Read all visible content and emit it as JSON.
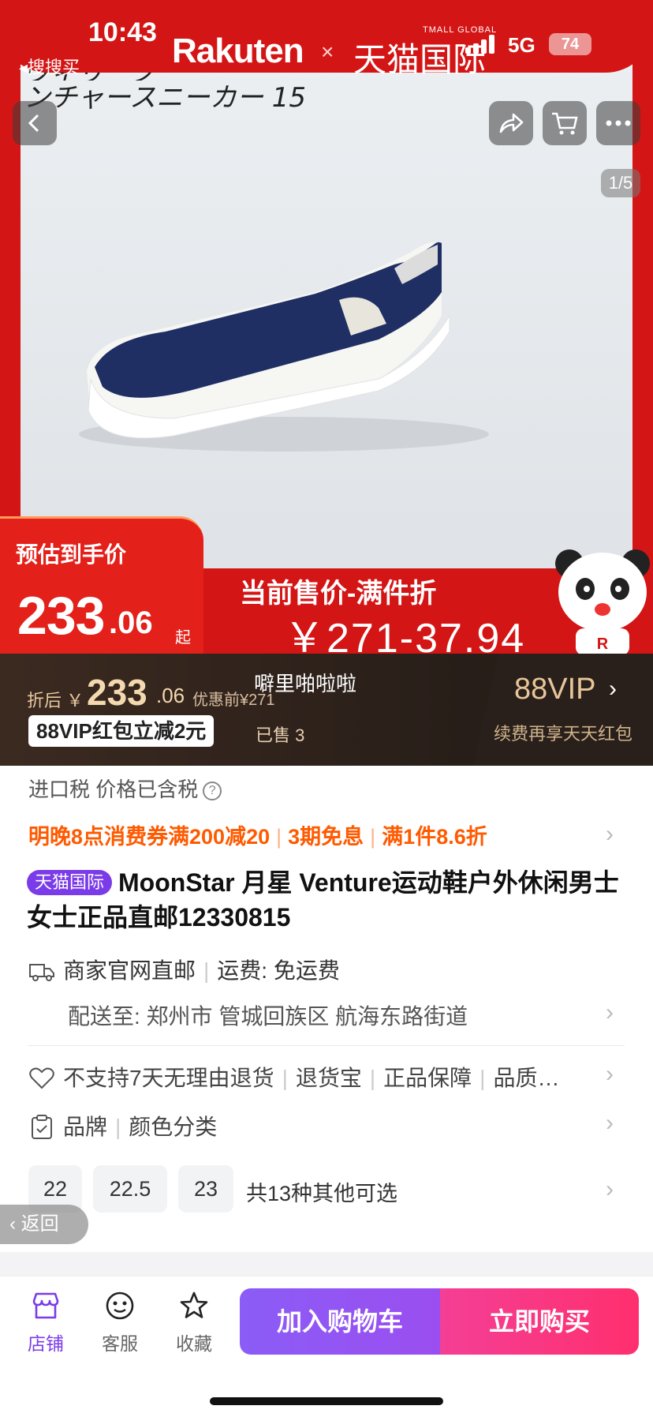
{
  "status_bar": {
    "time": "10:43",
    "back_app": "◂搜搜买",
    "network": "5G",
    "battery": "74"
  },
  "hero": {
    "brand_left": "Rakuten",
    "brand_sep": "×",
    "brand_right": "天猫国际",
    "brand_right_small": "TMALL GLOBAL",
    "jp_line1": "ヴィリーブ",
    "jp_line2": "ンチャースニーカー 15",
    "pager": "1/5",
    "est_label": "预估到手价",
    "est_int": "233",
    "est_dec": ".06",
    "est_suffix": "起",
    "cur_label": "当前售价-满件折",
    "cur_value": "￥271-37.94"
  },
  "vip": {
    "after_label": "折后",
    "price_symbol": "￥",
    "price_int": "233",
    "price_dec": ".06",
    "before": "优惠前¥271",
    "floating_text": "噼里啪啦啦",
    "redpacket": "88VIP红包立减2元",
    "sold": "已售 3",
    "vip_label": "88VIP",
    "renew": "续费再享天天红包"
  },
  "tax": {
    "label": "进口税 价格已含税"
  },
  "promo": {
    "items": [
      "明晚8点消费券满200减20",
      "3期免息",
      "满1件8.6折"
    ]
  },
  "product": {
    "tag": "天猫国际",
    "title": "MoonStar 月星 Venture运动鞋户外休闲男士女士正品直邮12330815"
  },
  "shipping": {
    "source": "商家官网直邮",
    "fee": "运费: 免运费",
    "deliver_to": "配送至: 郑州市 管城回族区 航海东路街道"
  },
  "services": {
    "items": [
      "不支持7天无理由退货",
      "退货宝",
      "正品保障",
      "品质…"
    ]
  },
  "attributes": {
    "items": [
      "品牌",
      "颜色分类"
    ]
  },
  "sizes": {
    "options": [
      "22",
      "22.5",
      "23"
    ],
    "more": "共13种其他可选"
  },
  "floating_back": "返回",
  "bottom_bar": {
    "store": "店铺",
    "service": "客服",
    "favorite": "收藏",
    "add_cart": "加入购物车",
    "buy_now": "立即购买"
  },
  "colors": {
    "accent_purple": "#7a3ce8",
    "banner_red": "#d41515",
    "promo_orange": "#ff5a00",
    "buy_pink": "#ff2f6e"
  }
}
